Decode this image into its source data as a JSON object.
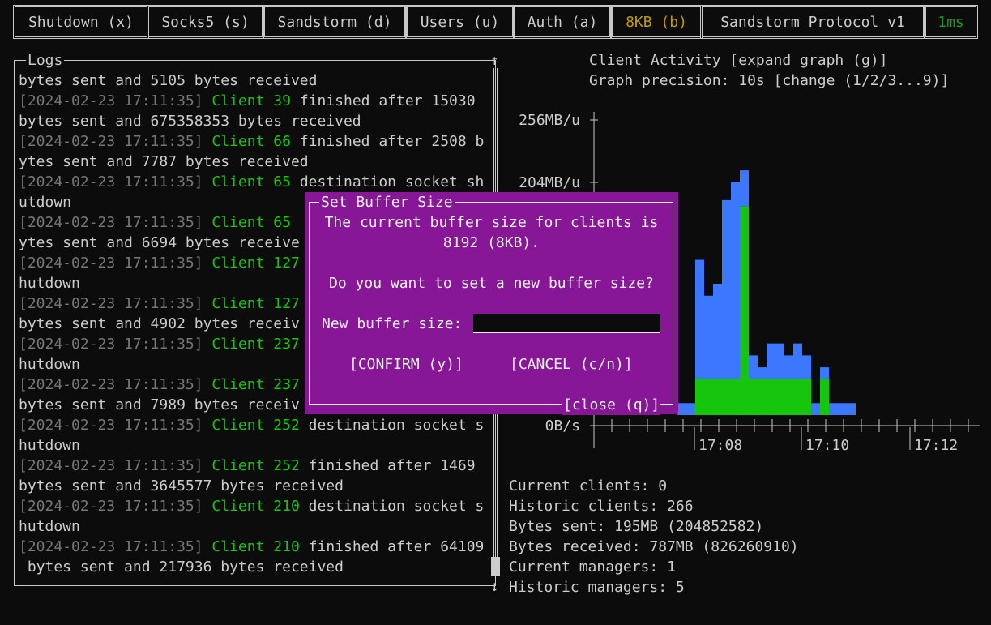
{
  "tabs": [
    {
      "label": "Shutdown (x)"
    },
    {
      "label": "Socks5 (s)"
    },
    {
      "label": "Sandstorm (d)"
    },
    {
      "label": "Users (u)"
    },
    {
      "label": "Auth (a)"
    },
    {
      "label": "8KB (b)"
    },
    {
      "label": "Sandstorm Protocol v1"
    },
    {
      "label": "1ms"
    }
  ],
  "logs": {
    "title": "Logs",
    "scroll_up": "↑",
    "scroll_down": "↓",
    "lines": [
      {
        "ts": "",
        "client": "",
        "text": "bytes sent and 5105 bytes received"
      },
      {
        "ts": "[2024-02-23 17:11:35]",
        "client": "Client 39",
        "text": "finished after 15030"
      },
      {
        "ts": "",
        "client": "",
        "text": "bytes sent and 675358353 bytes received"
      },
      {
        "ts": "[2024-02-23 17:11:35]",
        "client": "Client 66",
        "text": "finished after 2508 b"
      },
      {
        "ts": "",
        "client": "",
        "text": "ytes sent and 7787 bytes received"
      },
      {
        "ts": "[2024-02-23 17:11:35]",
        "client": "Client 65",
        "text": "destination socket sh"
      },
      {
        "ts": "",
        "client": "",
        "text": "utdown"
      },
      {
        "ts": "[2024-02-23 17:11:35]",
        "client": "Client 65",
        "text": ""
      },
      {
        "ts": "",
        "client": "",
        "text": "ytes sent and 6694 bytes receive"
      },
      {
        "ts": "[2024-02-23 17:11:35]",
        "client": "Client 127",
        "text": ""
      },
      {
        "ts": "",
        "client": "",
        "text": "hutdown"
      },
      {
        "ts": "[2024-02-23 17:11:35]",
        "client": "Client 127",
        "text": ""
      },
      {
        "ts": "",
        "client": "",
        "text": "bytes sent and 4902 bytes receiv"
      },
      {
        "ts": "[2024-02-23 17:11:35]",
        "client": "Client 237",
        "text": ""
      },
      {
        "ts": "",
        "client": "",
        "text": "hutdown"
      },
      {
        "ts": "[2024-02-23 17:11:35]",
        "client": "Client 237",
        "text": ""
      },
      {
        "ts": "",
        "client": "",
        "text": "bytes sent and 7989 bytes receiv"
      },
      {
        "ts": "[2024-02-23 17:11:35]",
        "client": "Client 252",
        "text": "destination socket s"
      },
      {
        "ts": "",
        "client": "",
        "text": "hutdown"
      },
      {
        "ts": "[2024-02-23 17:11:35]",
        "client": "Client 252",
        "text": "finished after 1469"
      },
      {
        "ts": "",
        "client": "",
        "text": "bytes sent and 3645577 bytes received"
      },
      {
        "ts": "[2024-02-23 17:11:35]",
        "client": "Client 210",
        "text": "destination socket s"
      },
      {
        "ts": "",
        "client": "",
        "text": "hutdown"
      },
      {
        "ts": "[2024-02-23 17:11:35]",
        "client": "Client 210",
        "text": "finished after 64109"
      },
      {
        "ts": "",
        "client": "",
        "text": " bytes sent and 217936 bytes received"
      }
    ]
  },
  "graph": {
    "title": "Client Activity [expand graph (g)]",
    "precision": "Graph precision: 10s [change (1/2/3...9)]"
  },
  "chart_data": {
    "type": "bar",
    "stacked": true,
    "y_tick_labels": [
      "256MB/u",
      "204MB/u",
      "0B/s"
    ],
    "x_tick_labels": [
      "17:08",
      "17:10",
      "17:12"
    ],
    "ylim_MB": [
      0,
      256
    ],
    "colors": {
      "sent": "#16c60c",
      "received": "#3b78ff"
    },
    "bars": [
      {
        "green": 0,
        "blue": 10
      },
      {
        "green": 0,
        "blue": 10
      },
      {
        "green": 30,
        "blue": 100
      },
      {
        "green": 30,
        "blue": 70
      },
      {
        "green": 30,
        "blue": 80
      },
      {
        "green": 30,
        "blue": 150
      },
      {
        "green": 30,
        "blue": 165
      },
      {
        "green": 175,
        "blue": 30
      },
      {
        "green": 30,
        "blue": 20
      },
      {
        "green": 30,
        "blue": 10
      },
      {
        "green": 30,
        "blue": 30
      },
      {
        "green": 30,
        "blue": 30
      },
      {
        "green": 30,
        "blue": 20
      },
      {
        "green": 30,
        "blue": 30
      },
      {
        "green": 30,
        "blue": 20
      },
      {
        "green": 0,
        "blue": 10
      },
      {
        "green": 30,
        "blue": 10
      },
      {
        "green": 0,
        "blue": 10
      },
      {
        "green": 0,
        "blue": 10
      },
      {
        "green": 0,
        "blue": 10
      }
    ]
  },
  "stats": [
    "Current clients: 0",
    "Historic clients: 266",
    "Bytes sent: 195MB (204852582)",
    "Bytes received: 787MB (826260910)",
    "Current managers: 1",
    "Historic managers: 5"
  ],
  "modal": {
    "title": "Set Buffer Size",
    "line1": "The current buffer size for clients is",
    "line2": "8192 (8KB).",
    "question": "Do you want to set a new buffer size?",
    "input_label": "New buffer size:",
    "input_value": "",
    "confirm": "[CONFIRM (y)]",
    "cancel": "[CANCEL (c/n)]",
    "close": "[close (q)]"
  }
}
